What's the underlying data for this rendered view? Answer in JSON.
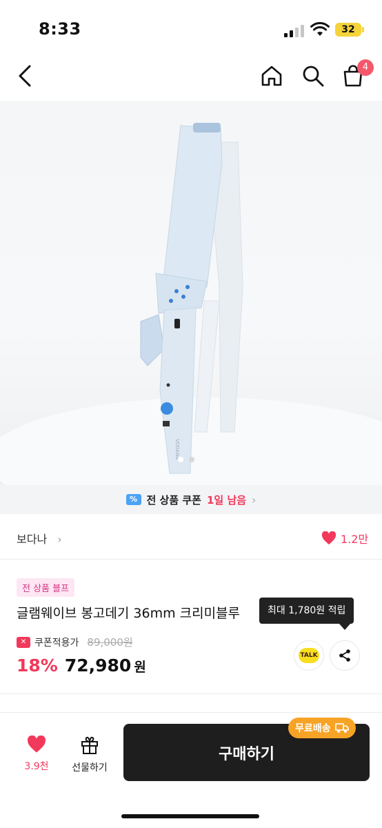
{
  "status_bar": {
    "time": "8:33",
    "battery": "32"
  },
  "header": {
    "cart_count": "4"
  },
  "coupon_banner": {
    "prefix": "전 상품 쿠폰",
    "highlight": "1일 남음",
    "coupon_icon": "%"
  },
  "brand": {
    "name": "보다나",
    "like_count": "1.2만"
  },
  "product": {
    "tag": "전 상품 블프",
    "title": "글램웨이브 봉고데기 36mm 크리미블루",
    "coupon_price_label": "쿠폰적용가",
    "original_price": "89,000원",
    "discount": "18%",
    "price": "72,980",
    "price_unit": "원",
    "point_tooltip": "최대 1,780원 적립",
    "talk_label": "TALK",
    "device_brand": "VODANA"
  },
  "bottom_bar": {
    "wish_count": "3.9천",
    "gift_label": "선물하기",
    "buy_label": "구매하기",
    "free_shipping": "무료배송"
  },
  "colors": {
    "accent": "#f2385b",
    "buy_button": "#1e1e1e",
    "free_shipping": "#f7a325"
  },
  "icons": [
    "back-icon",
    "home-icon",
    "search-icon",
    "cart-icon",
    "coupon-icon",
    "heart-icon",
    "coupon-tag-icon",
    "kakao-talk-icon",
    "share-icon",
    "gift-icon",
    "truck-icon"
  ]
}
